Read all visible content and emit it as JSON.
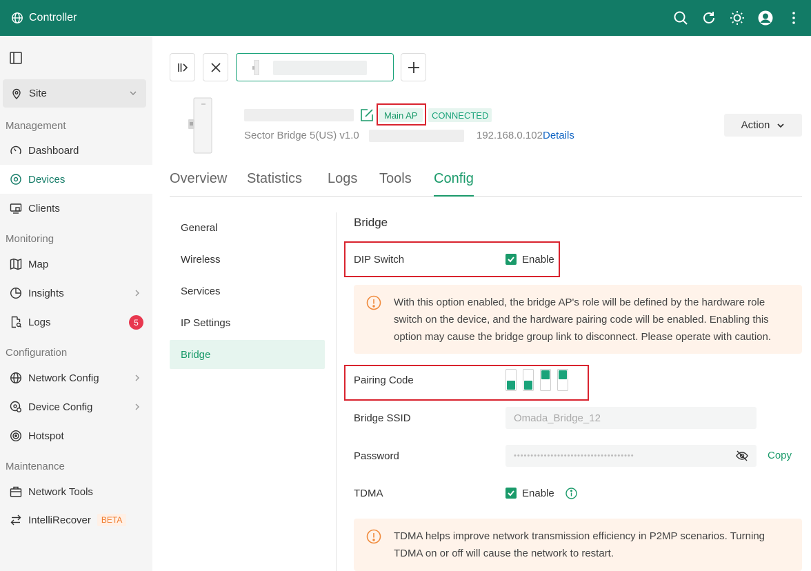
{
  "app": {
    "title": "Controller"
  },
  "topbar": {
    "icons": [
      "search-icon",
      "refresh-icon",
      "theme-sun-icon",
      "user-avatar-icon",
      "more-vertical-icon"
    ]
  },
  "sidebar": {
    "site_label": "Site",
    "sections": {
      "management": "Management",
      "monitoring": "Monitoring",
      "configuration": "Configuration",
      "maintenance": "Maintenance"
    },
    "items": {
      "dashboard": "Dashboard",
      "devices": "Devices",
      "clients": "Clients",
      "map": "Map",
      "insights": "Insights",
      "logs": "Logs",
      "logs_badge": "5",
      "network_config": "Network Config",
      "device_config": "Device Config",
      "hotspot": "Hotspot",
      "network_tools": "Network Tools",
      "intellirecover": "IntelliRecover",
      "beta": "BETA"
    },
    "active": "devices"
  },
  "device": {
    "role_tag": "Main AP",
    "status_tag": "CONNECTED",
    "model": "Sector Bridge 5(US) v1.0",
    "ip": "192.168.0.102",
    "details_link": "Details",
    "action_label": "Action"
  },
  "tabs": [
    "Overview",
    "Statistics",
    "Logs",
    "Tools",
    "Config"
  ],
  "active_tab": "Config",
  "config_menu": [
    "General",
    "Wireless",
    "Services",
    "IP Settings",
    "Bridge"
  ],
  "active_menu": "Bridge",
  "bridge": {
    "title": "Bridge",
    "dip_switch_label": "DIP Switch",
    "dip_switch_enable": "Enable",
    "dip_switch_checked": true,
    "dip_warning": "With this option enabled, the bridge AP's role will be defined by the hardware role switch on the device, and the hardware pairing code will be enabled. Enabling this option may cause the bridge group link to disconnect. Please operate with caution.",
    "pairing_code_label": "Pairing Code",
    "pairing_code_switches": [
      "down",
      "down",
      "up",
      "up"
    ],
    "ssid_label": "Bridge SSID",
    "ssid_value": "Omada_Bridge_12",
    "password_label": "Password",
    "password_mask": "••••••••••••••••••••••••••••••••••••",
    "copy_label": "Copy",
    "tdma_label": "TDMA",
    "tdma_enable": "Enable",
    "tdma_checked": true,
    "tdma_warning": "TDMA helps improve network transmission efficiency in P2MP scenarios. Turning TDMA on or off will cause the network to restart."
  },
  "colors": {
    "brand": "#127b66",
    "accent": "#1a9a6a",
    "badge": "#e8384f",
    "warning_bg": "#fff3ea",
    "highlight_box": "#d9232e"
  }
}
